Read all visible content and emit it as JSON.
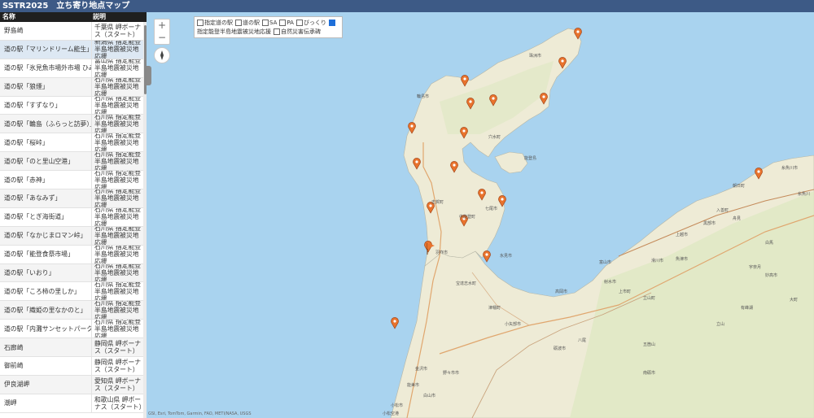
{
  "header": {
    "title": "SSTR2025　立ち寄り地点マップ"
  },
  "table": {
    "col_name": "名称",
    "col_desc": "説明",
    "rows": [
      {
        "name": "野島崎",
        "desc": "千葉県 岬ボーナス（スタート）"
      },
      {
        "name": "道の駅「マリンドリーム能生」",
        "desc": "新潟県 指定能登半島地震被災地応援"
      },
      {
        "name": "道の駅「氷見魚市場外市場 ひみ番屋街」",
        "desc": "富山県 指定能登半島地震被災地応援"
      },
      {
        "name": "道の駅「狼煙」",
        "desc": "石川県 指定能登半島地震被災地応援"
      },
      {
        "name": "道の駅「すずなり」",
        "desc": "石川県 指定能登半島地震被災地応援"
      },
      {
        "name": "道の駅「輪島（ふらっと訪夢）」",
        "desc": "石川県 指定能登半島地震被災地応援"
      },
      {
        "name": "道の駅「桜峠」",
        "desc": "石川県 指定能登半島地震被災地応援"
      },
      {
        "name": "道の駅「のと里山空港」",
        "desc": "石川県 指定能登半島地震被災地応援"
      },
      {
        "name": "道の駅「赤神」",
        "desc": "石川県 指定能登半島地震被災地応援"
      },
      {
        "name": "道の駅「あなみず」",
        "desc": "石川県 指定能登半島地震被災地応援"
      },
      {
        "name": "道の駅「とぎ海街道」",
        "desc": "石川県 指定能登半島地震被災地応援"
      },
      {
        "name": "道の駅「なかじまロマン峠」",
        "desc": "石川県 指定能登半島地震被災地応援"
      },
      {
        "name": "道の駅「能登食祭市場」",
        "desc": "石川県 指定能登半島地震被災地応援"
      },
      {
        "name": "道の駅「いおり」",
        "desc": "石川県 指定能登半島地震被災地応援"
      },
      {
        "name": "道の駅「ころ柿の里しか」",
        "desc": "石川県 指定能登半島地震被災地応援"
      },
      {
        "name": "道の駅「織姫の里なかのと」",
        "desc": "石川県 指定能登半島地震被災地応援"
      },
      {
        "name": "道の駅「内灘サンセットパーク」",
        "desc": "石川県 指定能登半島地震被災地応援"
      },
      {
        "name": "石廊崎",
        "desc": "静岡県 岬ボーナス（スタート）"
      },
      {
        "name": "御前崎",
        "desc": "静岡県 岬ボーナス（スタート）"
      },
      {
        "name": "伊良湖岬",
        "desc": "愛知県 岬ボーナス（スタート）"
      },
      {
        "name": "潮岬",
        "desc": "和歌山県 岬ボーナス（スタート）"
      }
    ]
  },
  "map": {
    "zoom_in": "+",
    "zoom_out": "−",
    "legend": {
      "items": [
        {
          "label": "指定道の駅",
          "checked": false
        },
        {
          "label": "道の駅",
          "checked": false
        },
        {
          "label": "SA",
          "checked": false
        },
        {
          "label": "PA",
          "checked": false
        },
        {
          "label": "びっくり",
          "checked": false
        },
        {
          "label": "",
          "checked": true
        }
      ],
      "line2": [
        {
          "label": "指定能登半島地震被災地応援",
          "checked": null
        },
        {
          "label": "自然災害伝承碑",
          "checked": false
        }
      ]
    },
    "attribution": "GSI, Esri, TomTom, Garmin, FAO, METI/NASA, USGS",
    "labels": [
      "珠洲市",
      "輪島市",
      "穴水町",
      "志賀町",
      "七尾市",
      "中能登町",
      "羽咋市",
      "氷見市",
      "能登島",
      "高岡市",
      "射水市",
      "富山市",
      "小矢部市",
      "砺波市",
      "金沢市",
      "白山市",
      "小松市",
      "能美市",
      "野々市市",
      "津幡町",
      "宝達志水町",
      "黒部市",
      "魚津市",
      "滑川市",
      "上市町",
      "立山町",
      "入善町",
      "朝日町",
      "糸魚川市",
      "上越市",
      "妙高市",
      "南砺市",
      "小松空港",
      "舟見",
      "宇奈月",
      "五箇山",
      "八尾",
      "立山",
      "有峰湖",
      "白馬",
      "大町",
      "糸魚川"
    ],
    "marker_color": "#e8732d"
  }
}
